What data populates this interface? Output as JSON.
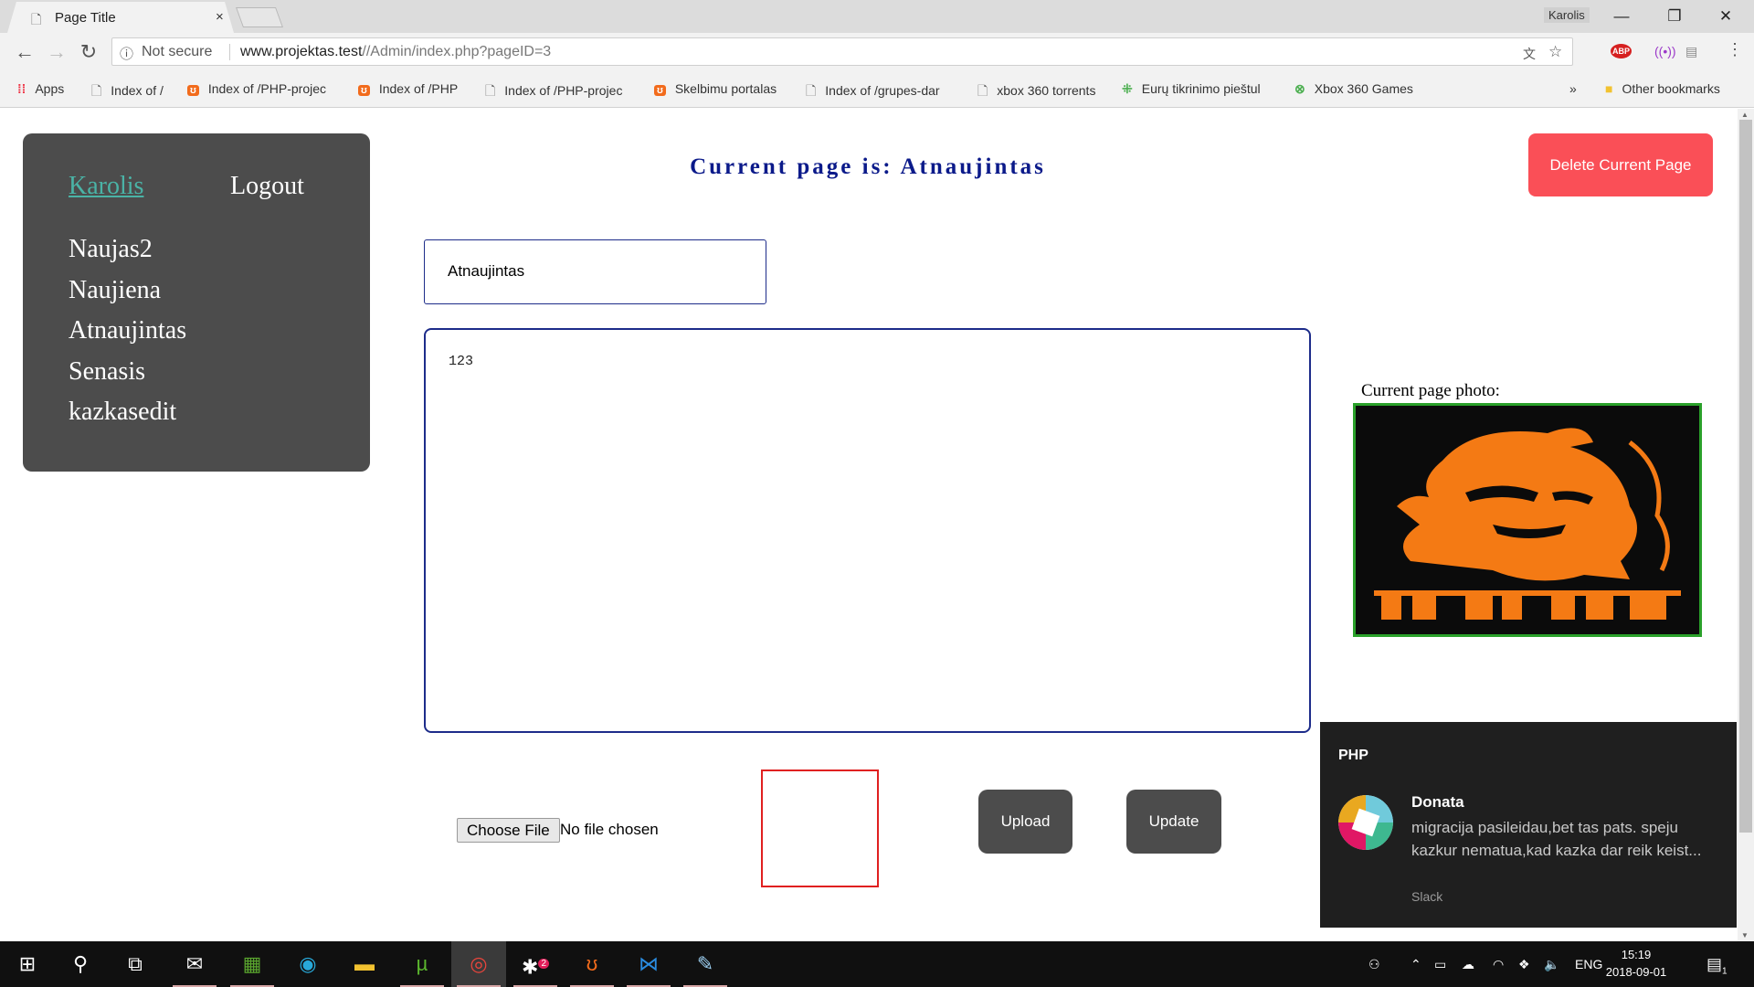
{
  "browser": {
    "tab_title": "Page Title",
    "tab_close": "×",
    "profile": "Karolis",
    "win_min": "—",
    "win_max": "❐",
    "win_close": "✕",
    "not_secure": "Not secure",
    "url_host": "www.projektas.test",
    "url_path": "//Admin/index.php?pageID=3",
    "bookmarks": [
      {
        "label": "Apps",
        "icon": "apps-grid-icon"
      },
      {
        "label": "Index of /",
        "icon": "page-icon"
      },
      {
        "label": "Index of /PHP-projec",
        "icon": "xampp-icon"
      },
      {
        "label": "Index of /PHP",
        "icon": "xampp-icon"
      },
      {
        "label": "Index of /PHP-projec",
        "icon": "page-icon"
      },
      {
        "label": "Skelbimu portalas",
        "icon": "xampp-icon"
      },
      {
        "label": "Index of /grupes-dar",
        "icon": "page-icon"
      },
      {
        "label": "xbox 360 torrents",
        "icon": "page-icon"
      },
      {
        "label": "Eurų tikrinimo pieštul",
        "icon": "green-dots-icon"
      },
      {
        "label": "Xbox 360 Games",
        "icon": "xbox-icon"
      }
    ],
    "bookmarks_overflow": "»",
    "other_bookmarks": "Other bookmarks"
  },
  "sidebar": {
    "user": "Karolis",
    "logout": "Logout",
    "pages": [
      "Naujas2",
      "Naujiena",
      "Atnaujintas",
      "Senasis",
      "kazkasedit"
    ]
  },
  "main": {
    "page_title": "Current page is: Atnaujintas",
    "delete_label": "Delete Current Page",
    "title_value": "Atnaujintas",
    "content_value": "123",
    "photo_label": "Current page photo:",
    "choose_file": "Choose File",
    "no_file": "No file chosen",
    "upload_label": "Upload",
    "update_label": "Update"
  },
  "notification": {
    "app": "PHP",
    "sender": "Donata",
    "body": "migracija pasileidau,bet tas pats. speju kazkur nematua,kad kazka dar reik keist...",
    "source": "Slack"
  },
  "taskbar": {
    "language": "ENG",
    "time": "15:19",
    "date": "2018-09-01",
    "notification_count": "1",
    "badge_count": "2"
  },
  "colors": {
    "accent_link": "#4ab3a6",
    "title_navy": "#0b1a8a",
    "delete_red": "#fa4f57",
    "sidebar_gray": "#4c4c4c",
    "photo_border": "#2aa02a",
    "photo_orange": "#f47a14"
  }
}
